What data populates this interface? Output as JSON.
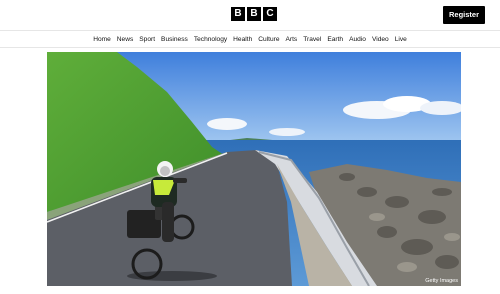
{
  "header": {
    "logo_letters": [
      "B",
      "B",
      "C"
    ],
    "register_label": "Register"
  },
  "nav": {
    "items": [
      {
        "label": "Home"
      },
      {
        "label": "News"
      },
      {
        "label": "Sport"
      },
      {
        "label": "Business"
      },
      {
        "label": "Technology"
      },
      {
        "label": "Health"
      },
      {
        "label": "Culture"
      },
      {
        "label": "Arts"
      },
      {
        "label": "Travel"
      },
      {
        "label": "Earth"
      },
      {
        "label": "Audio"
      },
      {
        "label": "Video"
      },
      {
        "label": "Live"
      }
    ]
  },
  "hero": {
    "credit": "Getty Images"
  }
}
